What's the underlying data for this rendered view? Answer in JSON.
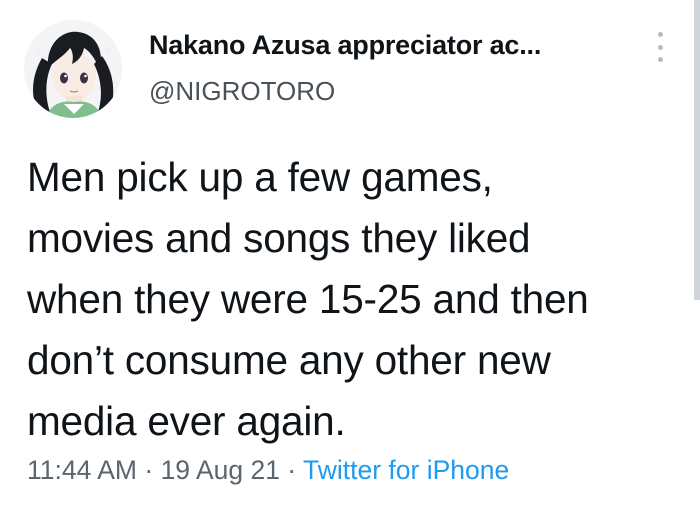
{
  "tweet": {
    "display_name": "Nakano Azusa appreciator ac...",
    "handle": "@NIGROTORO",
    "text_lines": [
      "Men pick up a few games,",
      "movies and songs they liked",
      "when they were 15-25 and then",
      "don’t consume any other new",
      "media ever again."
    ],
    "time": "11:44 AM",
    "separator": " · ",
    "date": "19 Aug 21",
    "source": "Twitter for iPhone"
  },
  "icons": {
    "more": "more-vertical-icon",
    "avatar": "anime-avatar"
  },
  "colors": {
    "text": "#0f1419",
    "secondary": "#5b656e",
    "link": "#1d9bf0",
    "more_dots": "#b5bcc2"
  }
}
